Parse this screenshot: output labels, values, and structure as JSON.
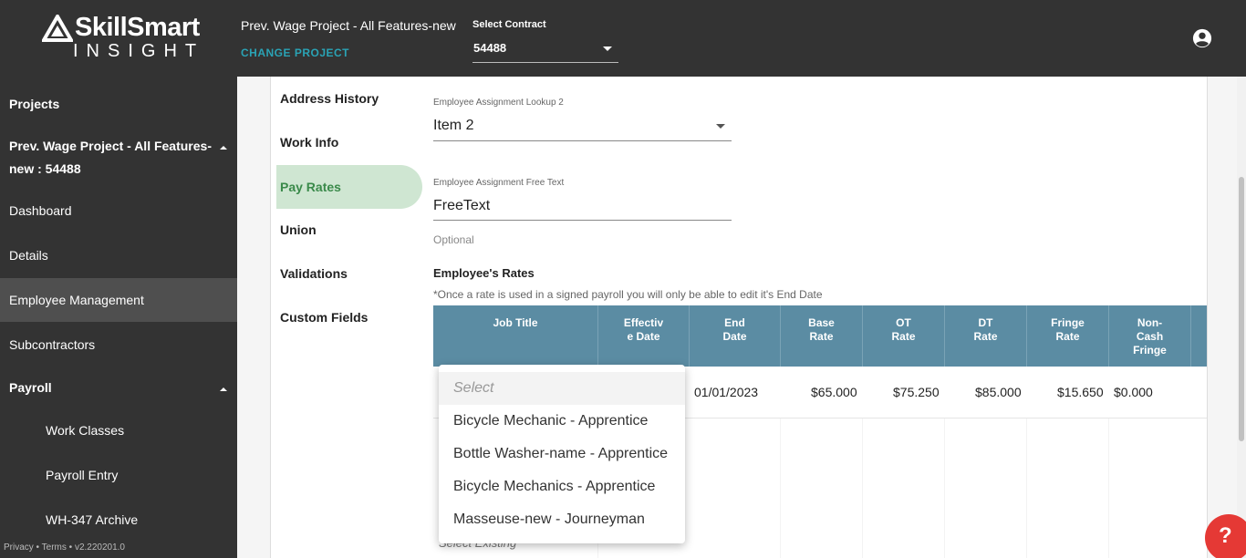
{
  "header": {
    "logo_top": "SkillSmart",
    "logo_bottom": "INSIGHT",
    "project_title": "Prev. Wage Project - All Features-new",
    "change_project": "CHANGE PROJECT",
    "contract_label": "Select Contract",
    "contract_value": "54488"
  },
  "sidebar": {
    "projects": "Projects",
    "current_project_line1": "Prev. Wage Project - All Features-",
    "current_project_line2": "new : 54488",
    "dashboard": "Dashboard",
    "details": "Details",
    "employee_management": "Employee Management",
    "subcontractors": "Subcontractors",
    "payroll": "Payroll",
    "work_classes": "Work Classes",
    "payroll_entry": "Payroll Entry",
    "wh347_archive": "WH-347 Archive",
    "footer": "Privacy • Terms • v2.220201.0"
  },
  "subnav": {
    "address_history": "Address History",
    "work_info": "Work Info",
    "pay_rates": "Pay Rates",
    "union": "Union",
    "validations": "Validations",
    "custom_fields": "Custom Fields"
  },
  "form": {
    "lookup_label": "Employee Assignment Lookup 2",
    "lookup_value": "Item 2",
    "free_text_label": "Employee Assignment Free Text",
    "free_text_value": "FreeText",
    "free_text_hint": "Optional",
    "rates_title": "Employee's Rates",
    "rates_note": "*Once a rate is used in a signed payroll you will only be able to edit it's End Date"
  },
  "table": {
    "headers": {
      "job_title": "Job Title",
      "effective_date_1": "Effectiv",
      "effective_date_2": "e Date",
      "end_date_1": "End",
      "end_date_2": "Date",
      "base_rate_1": "Base",
      "base_rate_2": "Rate",
      "ot_rate_1": "OT",
      "ot_rate_2": "Rate",
      "dt_rate_1": "DT",
      "dt_rate_2": "Rate",
      "fringe_rate_1": "Fringe",
      "fringe_rate_2": "Rate",
      "non_cash_1": "Non-",
      "non_cash_2": "Cash",
      "non_cash_3": "Fringe"
    },
    "row": {
      "end_date": "01/01/2023",
      "base_rate": "$65.000",
      "ot_rate": "$75.250",
      "dt_rate": "$85.000",
      "fringe_rate": "$15.650",
      "non_cash_fringe": "$0.000"
    },
    "below_text": "Select Existing"
  },
  "dropdown": {
    "placeholder": "Select",
    "options": [
      "Bicycle Mechanic - Apprentice",
      "Bottle Washer-name - Apprentice",
      "Bicycle Mechanics - Apprentice",
      "Masseuse-new - Journeyman"
    ]
  },
  "help": {
    "label": "?"
  },
  "colors": {
    "topbar": "#333333",
    "accent_teal": "#2aa3b5",
    "table_header": "#5b8ca3",
    "active_subnav_bg": "#cfe6d2",
    "active_subnav_text": "#3a8a4a",
    "help_button": "#e53935"
  },
  "icons": {
    "user": "account-circle-icon",
    "caret": "caret-up-icon",
    "dropdown_arrow": "chevron-down-icon"
  }
}
